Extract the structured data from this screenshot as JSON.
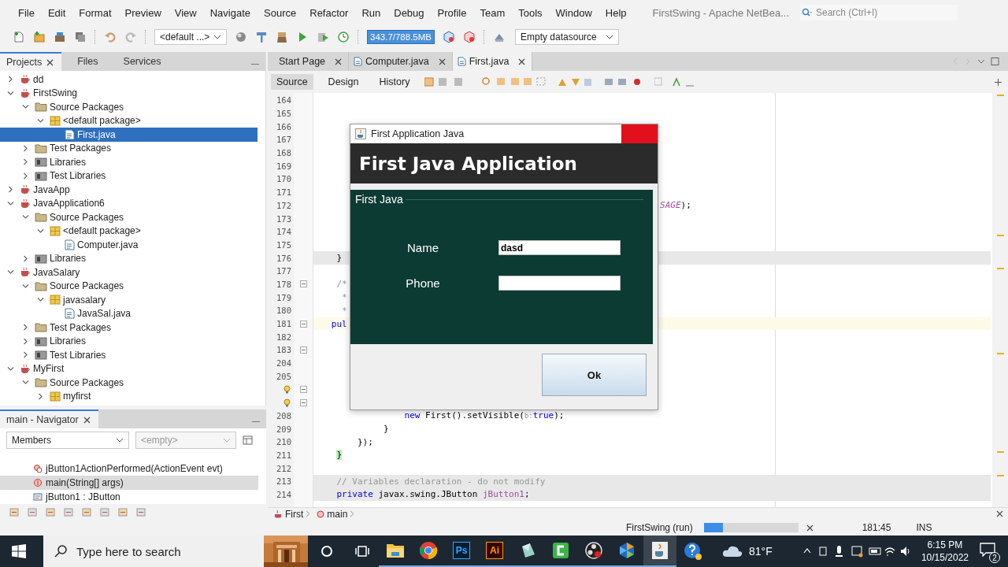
{
  "menu_bar": {
    "items": [
      "File",
      "Edit",
      "Format",
      "Preview",
      "View",
      "Navigate",
      "Source",
      "Refactor",
      "Run",
      "Debug",
      "Profile",
      "Team",
      "Tools",
      "Window",
      "Help"
    ],
    "title": "FirstSwing - Apache NetBea...",
    "search": {
      "placeholder": "Search (Ctrl+I)"
    }
  },
  "toolbar": {
    "configuration": "<default ...>",
    "memory": "343.7/788.5MB",
    "datasource": "Empty datasource"
  },
  "projects": {
    "tabs": [
      {
        "label": "Projects",
        "selected": true
      },
      {
        "label": "Files",
        "selected": false
      },
      {
        "label": "Services",
        "selected": false
      }
    ],
    "tree": [
      {
        "label": "dd",
        "kind": "project",
        "expanded": false,
        "selected": false
      },
      {
        "label": "FirstSwing",
        "kind": "project",
        "expanded": true,
        "selected": false,
        "children": [
          {
            "label": "Source Packages",
            "kind": "folder",
            "expanded": true,
            "selected": false,
            "children": [
              {
                "label": "<default package>",
                "kind": "package",
                "expanded": true,
                "selected": false,
                "children": [
                  {
                    "label": "First.java",
                    "kind": "file",
                    "selected": true
                  }
                ]
              }
            ]
          },
          {
            "label": "Test Packages",
            "kind": "folder",
            "expanded": false,
            "selected": false
          },
          {
            "label": "Libraries",
            "kind": "library",
            "expanded": false,
            "selected": false
          },
          {
            "label": "Test Libraries",
            "kind": "library",
            "expanded": false,
            "selected": false
          }
        ]
      },
      {
        "label": "JavaApp",
        "kind": "project",
        "expanded": false,
        "selected": false
      },
      {
        "label": "JavaApplication6",
        "kind": "project",
        "expanded": true,
        "selected": false,
        "children": [
          {
            "label": "Source Packages",
            "kind": "folder",
            "expanded": true,
            "selected": false,
            "children": [
              {
                "label": "<default package>",
                "kind": "package",
                "expanded": true,
                "selected": false,
                "children": [
                  {
                    "label": "Computer.java",
                    "kind": "file",
                    "selected": false
                  }
                ]
              }
            ]
          },
          {
            "label": "Libraries",
            "kind": "library",
            "expanded": false,
            "selected": false
          }
        ]
      },
      {
        "label": "JavaSalary",
        "kind": "project",
        "expanded": true,
        "selected": false,
        "children": [
          {
            "label": "Source Packages",
            "kind": "folder",
            "expanded": true,
            "selected": false,
            "children": [
              {
                "label": "javasalary",
                "kind": "package",
                "expanded": true,
                "selected": false,
                "children": [
                  {
                    "label": "JavaSal.java",
                    "kind": "file",
                    "selected": false
                  }
                ]
              }
            ]
          },
          {
            "label": "Test Packages",
            "kind": "folder",
            "expanded": false,
            "selected": false
          },
          {
            "label": "Libraries",
            "kind": "library",
            "expanded": false,
            "selected": false
          },
          {
            "label": "Test Libraries",
            "kind": "library",
            "expanded": false,
            "selected": false
          }
        ]
      },
      {
        "label": "MyFirst",
        "kind": "project",
        "expanded": true,
        "selected": false,
        "children": [
          {
            "label": "Source Packages",
            "kind": "folder",
            "expanded": true,
            "selected": false,
            "children": [
              {
                "label": "myfirst",
                "kind": "package",
                "expanded": false,
                "selected": false
              }
            ]
          }
        ]
      }
    ]
  },
  "navigator": {
    "title": "main - Navigator",
    "filter": "Members",
    "scope": "<empty>",
    "items": [
      {
        "label": "jButton1ActionPerformed(ActionEvent evt)",
        "kind": "method",
        "selected": false
      },
      {
        "label": "main(String[] args)",
        "kind": "static-method",
        "selected": true
      },
      {
        "label": "jButton1 : JButton",
        "kind": "field",
        "selected": false
      }
    ]
  },
  "editor": {
    "tabs": [
      {
        "label": "Start Page",
        "kind": "page",
        "selected": false
      },
      {
        "label": "Computer.java",
        "kind": "file",
        "selected": false
      },
      {
        "label": "First.java",
        "kind": "file",
        "selected": true
      }
    ],
    "views": [
      {
        "label": "Source",
        "selected": true
      },
      {
        "label": "Design",
        "selected": false
      },
      {
        "label": "History",
        "selected": false
      }
    ],
    "lines": [
      {
        "number": "164",
        "guarded": false,
        "current": false
      },
      {
        "number": "165",
        "guarded": false,
        "current": false
      },
      {
        "number": "166",
        "guarded": false,
        "current": false
      },
      {
        "number": "167",
        "guarded": false,
        "current": false
      },
      {
        "number": "168",
        "guarded": false,
        "current": false
      },
      {
        "number": "169",
        "guarded": false,
        "current": false
      },
      {
        "number": "170",
        "guarded": false,
        "current": false
      },
      {
        "number": "171",
        "guarded": false,
        "current": false
      },
      {
        "number": "172",
        "guarded": false,
        "current": false,
        "tokens": [
          {
            "text": "                                                                  SAGE",
            "kind": "constant"
          },
          {
            "text": ");",
            "kind": "plain"
          }
        ]
      },
      {
        "number": "173",
        "guarded": false,
        "current": false
      },
      {
        "number": "174",
        "guarded": false,
        "current": false
      },
      {
        "number": "175",
        "guarded": false,
        "current": false
      },
      {
        "number": "176",
        "guarded": true,
        "current": false,
        "tokens": [
          {
            "text": "    }",
            "kind": "plain"
          }
        ]
      },
      {
        "number": "177",
        "guarded": false,
        "current": false
      },
      {
        "number": "178",
        "guarded": false,
        "current": false,
        "fold": true,
        "tokens": [
          {
            "text": "    /*",
            "kind": "comment"
          }
        ]
      },
      {
        "number": "179",
        "guarded": false,
        "current": false,
        "tokens": [
          {
            "text": "     *",
            "kind": "comment"
          }
        ]
      },
      {
        "number": "180",
        "guarded": false,
        "current": false,
        "tokens": [
          {
            "text": "     *",
            "kind": "comment"
          }
        ]
      },
      {
        "number": "181",
        "guarded": false,
        "current": true,
        "fold": true,
        "tokens": [
          {
            "text": "   pul",
            "kind": "keyword"
          }
        ]
      },
      {
        "number": "182",
        "guarded": false,
        "current": false
      },
      {
        "number": "183",
        "guarded": false,
        "current": false,
        "fold": true
      },
      {
        "number": "204",
        "guarded": false,
        "current": false
      },
      {
        "number": "205",
        "guarded": false,
        "current": false
      },
      {
        "kind": "marker",
        "guarded": false,
        "current": false,
        "fold": true
      },
      {
        "kind": "marker",
        "guarded": false,
        "current": false,
        "fold": true
      },
      {
        "number": "208",
        "guarded": false,
        "current": false,
        "tokens": [
          {
            "text": "                 new",
            "kind": "keyword"
          },
          {
            "text": " First().setVisible(",
            "kind": "plain"
          },
          {
            "text": "b:",
            "kind": "hint"
          },
          {
            "text": "true",
            "kind": "keyword"
          },
          {
            "text": ");",
            "kind": "plain"
          }
        ]
      },
      {
        "number": "209",
        "guarded": false,
        "current": false,
        "tokens": [
          {
            "text": "             }",
            "kind": "plain"
          }
        ]
      },
      {
        "number": "210",
        "guarded": false,
        "current": false,
        "tokens": [
          {
            "text": "        });",
            "kind": "plain"
          }
        ]
      },
      {
        "number": "211",
        "guarded": false,
        "current": false,
        "tokens": [
          {
            "text": "    }",
            "kind": "match"
          }
        ]
      },
      {
        "number": "212",
        "guarded": false,
        "current": false
      },
      {
        "number": "213",
        "guarded": true,
        "current": false,
        "tokens": [
          {
            "text": "    // Variables declaration - do not modify",
            "kind": "comment"
          }
        ]
      },
      {
        "number": "214",
        "guarded": true,
        "current": false,
        "tokens": [
          {
            "text": "    private",
            "kind": "keyword"
          },
          {
            "text": " javax.swing.JButton ",
            "kind": "plain"
          },
          {
            "text": "jButton1",
            "kind": "field"
          },
          {
            "text": ";",
            "kind": "plain"
          }
        ]
      }
    ],
    "breadcrumbs": [
      "First",
      "main"
    ]
  },
  "dialog": {
    "title": "First Application Java",
    "heading": "First Java Application",
    "panel_title": "First Java",
    "fields": [
      {
        "label": "Name",
        "value": "dasd"
      },
      {
        "label": "Phone"
      }
    ],
    "button": "Ok"
  },
  "status_bar": {
    "task": "FirstSwing (run)",
    "level": 0.2,
    "position": "181:45",
    "mode": "INS"
  },
  "taskbar": {
    "search": {
      "placeholder": "Type here to search"
    },
    "apps": [
      {
        "kind": "explorer",
        "running": true,
        "selected": false
      },
      {
        "kind": "chrome",
        "running": true,
        "selected": false
      },
      {
        "kind": "ps",
        "label": "Ps",
        "running": true,
        "selected": false
      },
      {
        "kind": "ai",
        "label": "Ai",
        "running": true,
        "selected": false
      },
      {
        "kind": "crystal",
        "running": true,
        "selected": false
      },
      {
        "kind": "camtasia",
        "running": true,
        "selected": false
      },
      {
        "kind": "obs",
        "running": true,
        "selected": false
      },
      {
        "kind": "netbeans",
        "running": true,
        "selected": false
      },
      {
        "kind": "java",
        "running": true,
        "selected": true
      },
      {
        "kind": "help",
        "running": false,
        "selected": false
      }
    ],
    "weather": "81°F",
    "time": "6:15 PM",
    "date": "10/15/2022",
    "notifications": "2"
  }
}
